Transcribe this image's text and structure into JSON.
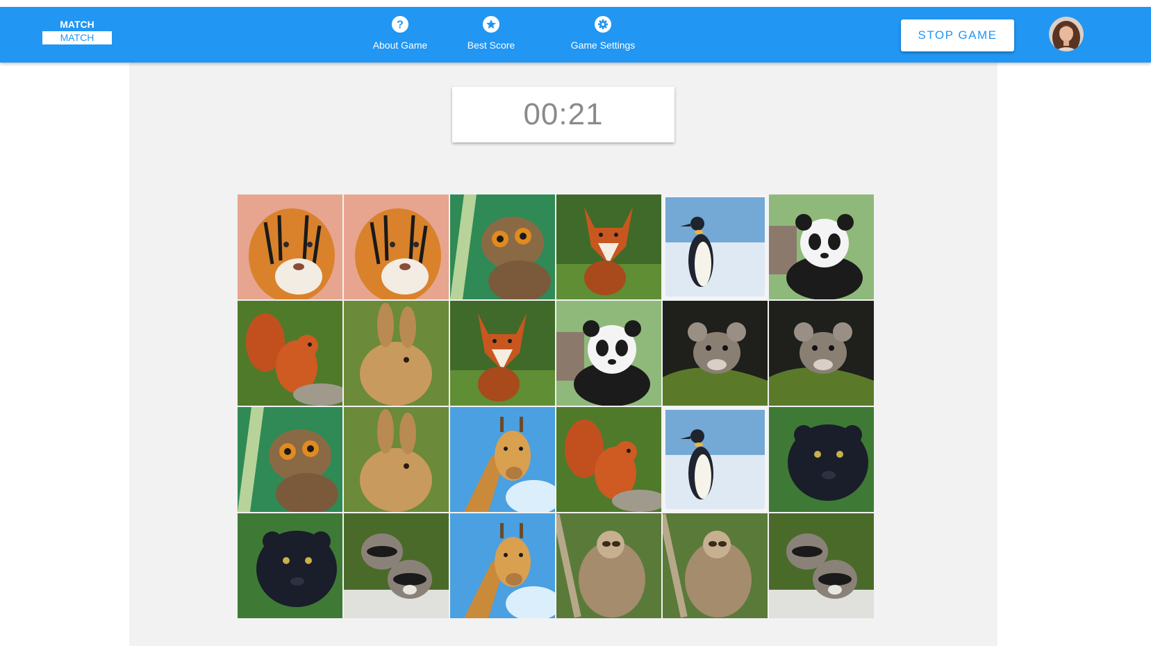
{
  "app": {
    "logo_top": "MATCH",
    "logo_bottom": "MATCH"
  },
  "nav": [
    {
      "label": "About Game",
      "icon": "question-icon"
    },
    {
      "label": "Best Score",
      "icon": "star-icon"
    },
    {
      "label": "Game Settings",
      "icon": "gear-icon"
    }
  ],
  "header": {
    "stop_label": "STOP GAME",
    "avatar": "user-avatar"
  },
  "game": {
    "timer": "00:21",
    "cards": [
      [
        "tiger",
        "tiger",
        "tarsier",
        "fox",
        "penguin",
        "panda"
      ],
      [
        "squirrel",
        "rabbit",
        "fox",
        "panda",
        "mouse",
        "mouse"
      ],
      [
        "tarsier",
        "rabbit",
        "giraffe",
        "squirrel",
        "penguin",
        "panther"
      ],
      [
        "panther",
        "raccoon",
        "giraffe",
        "sloth",
        "sloth",
        "raccoon"
      ]
    ]
  },
  "colors": {
    "header": "#2196f3",
    "background": "#f2f2f2",
    "timer_text": "#8a8a8a"
  }
}
